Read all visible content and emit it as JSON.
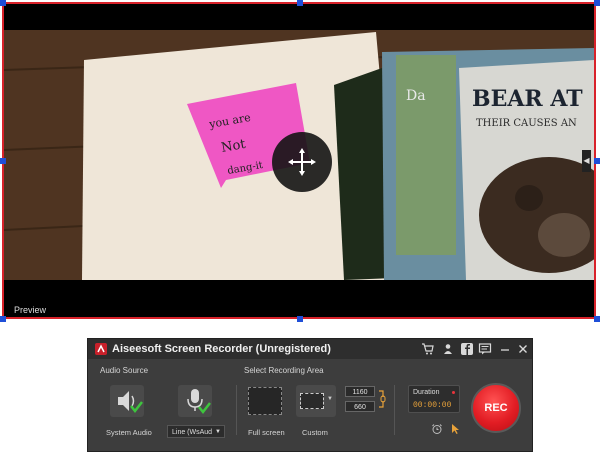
{
  "capture": {
    "preview_label": "Preview"
  },
  "recorder": {
    "title": "Aiseesoft Screen Recorder (Unregistered)",
    "audio_source_label": "Audio Source",
    "select_area_label": "Select Recording Area",
    "system_audio_caption": "System Audio",
    "line_select_value": "Line (WsAud",
    "full_screen_caption": "Full screen",
    "custom_caption": "Custom",
    "width_value": "1160",
    "height_value": "660",
    "duration_label": "Duration",
    "duration_value": "00:00:00",
    "rec_label": "REC"
  },
  "colors": {
    "frame_border": "#d8222a",
    "handle": "#1f4fd8",
    "rec_button": "#e21d24",
    "duration_text": "#e8a23a",
    "check_green": "#3ec43e"
  },
  "icons": {
    "move": "move-arrows-icon",
    "shopping_cart": "cart-icon",
    "user": "user-icon",
    "facebook": "facebook-icon",
    "message": "message-icon",
    "minimize": "minimize-icon",
    "close": "close-icon",
    "speaker": "speaker-icon",
    "microphone": "microphone-icon",
    "alarm": "alarm-clock-icon",
    "cursor": "cursor-icon",
    "link": "link-icon"
  }
}
